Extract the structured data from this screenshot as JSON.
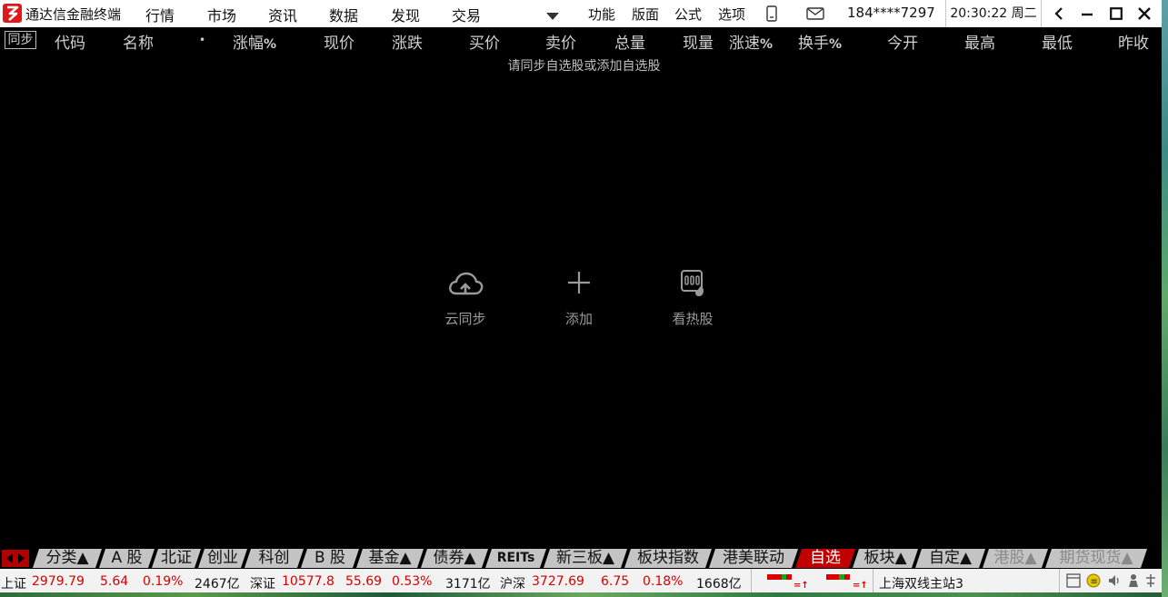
{
  "app": {
    "title": "通达信金融终端",
    "menu": [
      "行情",
      "市场",
      "资讯",
      "数据",
      "发现",
      "交易"
    ],
    "right_menu": [
      "功能",
      "版面",
      "公式",
      "选项"
    ],
    "account": "184****7297",
    "clock": "20:30:22 周二"
  },
  "columns": {
    "sync_label": "同步",
    "names": [
      "代码",
      "名称",
      "•",
      "涨幅",
      "现价",
      "涨跌",
      "买价",
      "卖价",
      "总量",
      "现量",
      "涨速",
      "换手",
      "今开",
      "最高",
      "最低",
      "昨收"
    ],
    "percent_suffix": "%"
  },
  "empty_hint": "请同步自选股或添加自选股",
  "actions": [
    {
      "label": "云同步",
      "icon": "cloud-upload-icon"
    },
    {
      "label": "添加",
      "icon": "plus-icon"
    },
    {
      "label": "看热股",
      "icon": "hot-stock-icon"
    }
  ],
  "tabs": [
    "分类▲",
    "A 股",
    "北证",
    "创业",
    "科创",
    "B 股",
    "基金▲",
    "债券▲",
    "REITs",
    "新三板▲",
    "板块指数",
    "港美联动",
    "自选",
    "板块▲",
    "自定▲",
    "港股▲",
    "期货现货▲"
  ],
  "active_tab": "自选",
  "status": {
    "sh": {
      "label": "上证",
      "index": "2979.79",
      "change": "5.64",
      "pct": "0.19%",
      "amount": "2467亿"
    },
    "sz": {
      "label": "深证",
      "index": "10577.8",
      "change": "55.69",
      "pct": "0.53%",
      "amount": "3171亿"
    },
    "hs": {
      "label": "沪深",
      "index": "3727.69",
      "change": "6.75",
      "pct": "0.18%",
      "amount": "1668亿"
    },
    "server": "上海双线主站3"
  },
  "colors": {
    "up": "#d80000",
    "active_tab": "#c00000",
    "brand": "#e01818"
  }
}
